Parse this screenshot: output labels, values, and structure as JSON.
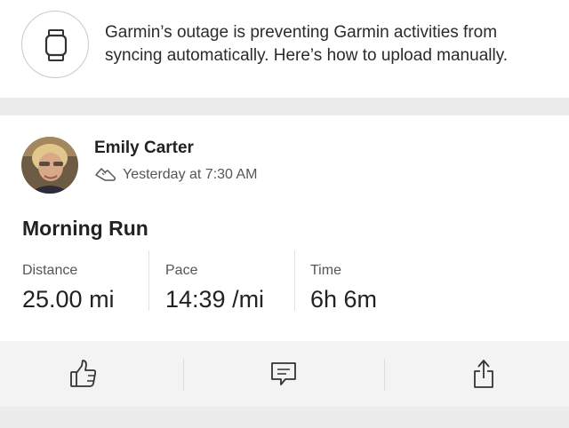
{
  "notice": {
    "icon": "watch-icon",
    "text": "Garmin’s outage is preventing Garmin activities from syncing automatically. Here’s how to upload manually."
  },
  "activity": {
    "athlete_name": "Emily Carter",
    "sport_icon": "shoe-icon",
    "timestamp": "Yesterday at 7:30 AM",
    "title": "Morning Run",
    "stats": [
      {
        "label": "Distance",
        "value": "25.00 mi"
      },
      {
        "label": "Pace",
        "value": "14:39 /mi"
      },
      {
        "label": "Time",
        "value": "6h 6m"
      }
    ]
  },
  "actions": [
    {
      "name": "kudos",
      "icon": "thumbs-up-icon"
    },
    {
      "name": "comment",
      "icon": "comment-icon"
    },
    {
      "name": "share",
      "icon": "share-icon"
    }
  ],
  "colors": {
    "background": "#ffffff",
    "separator": "#ececec",
    "action_bar": "#f3f3f3",
    "text": "#222222",
    "muted_text": "#555555"
  }
}
